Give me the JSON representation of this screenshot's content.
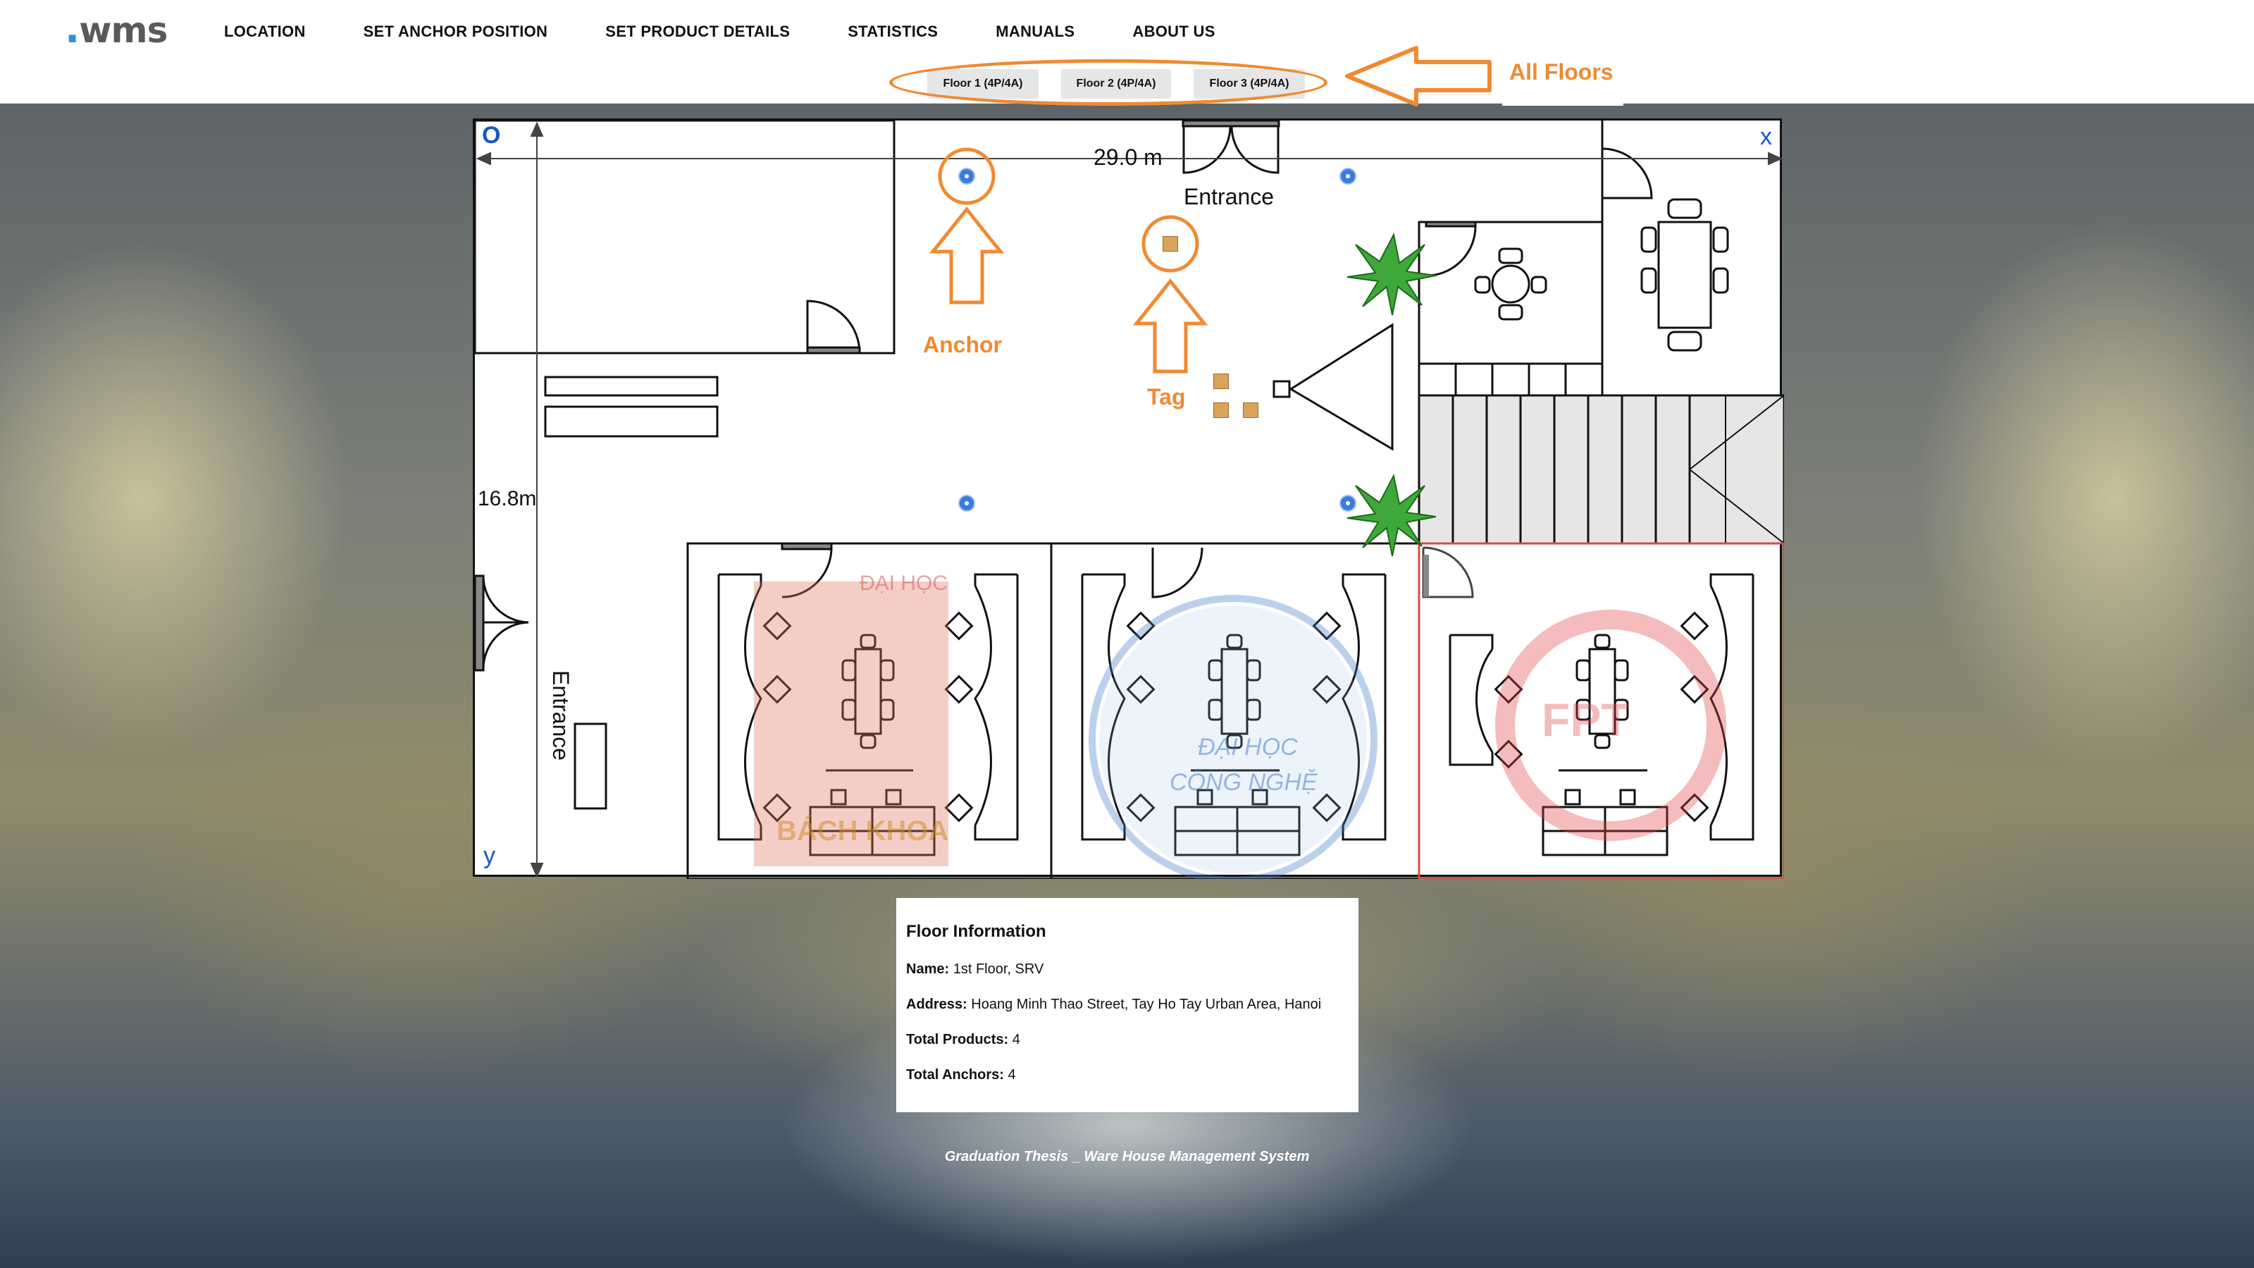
{
  "app": {
    "logo_text": "wms",
    "nav": [
      {
        "label": "LOCATION"
      },
      {
        "label": "SET ANCHOR POSITION"
      },
      {
        "label": "SET PRODUCT DETAILS"
      },
      {
        "label": "STATISTICS"
      },
      {
        "label": "MANUALS"
      },
      {
        "label": "ABOUT US"
      }
    ]
  },
  "floors": [
    {
      "label": "Floor 1 (4P/4A)"
    },
    {
      "label": "Floor 2 (4P/4A)"
    },
    {
      "label": "Floor 3 (4P/4A)"
    }
  ],
  "annotations": {
    "all_floors": "All Floors",
    "anchor": "Anchor",
    "tag": "Tag"
  },
  "plan": {
    "origin_label": "O",
    "x_label": "x",
    "y_label": "y",
    "width_label": "29.0 m",
    "height_label": "16.8m",
    "entrance_top": "Entrance",
    "entrance_left": "Entrance",
    "room_logos": [
      "ĐẠI HỌC",
      "BÁCH KHOA",
      "ĐẠI HỌC",
      "CÔNG NGHỆ",
      "FPT"
    ]
  },
  "floor_info": {
    "title": "Floor Information",
    "name_label": "Name:",
    "name_value": "1st Floor, SRV",
    "address_label": "Address:",
    "address_value": "Hoang Minh Thao Street, Tay Ho Tay Urban Area, Hanoi",
    "products_label": "Total Products:",
    "products_value": "4",
    "anchors_label": "Total Anchors:",
    "anchors_value": "4"
  },
  "footer": "Graduation Thesis _ Ware House Management System",
  "colors": {
    "annotation": "#f08a32",
    "anchor": "#3a7be0",
    "axis": "#1a56c4"
  }
}
